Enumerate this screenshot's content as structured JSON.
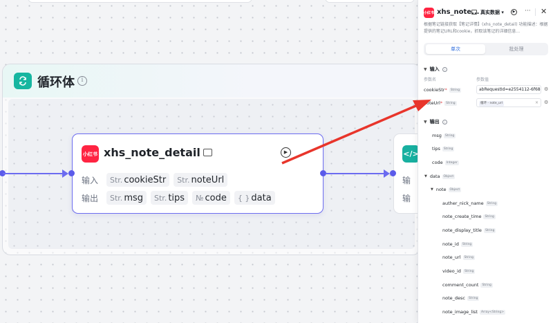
{
  "canvas": {
    "loop": {
      "title": "循环体"
    },
    "node": {
      "logo_text": "小红书",
      "title": "xhs_note_detail",
      "input_label": "输入",
      "output_label": "输出",
      "inputs": [
        {
          "type": "Str.",
          "name": "cookieStr"
        },
        {
          "type": "Str.",
          "name": "noteUrl"
        }
      ],
      "outputs": [
        {
          "type": "Str.",
          "name": "msg"
        },
        {
          "type": "Str.",
          "name": "tips"
        },
        {
          "type": "№",
          "name": "code"
        },
        {
          "type": "{ }",
          "name": "data"
        }
      ]
    },
    "next_node": {
      "logo_text": "</>",
      "input_label": "输",
      "output_label": "输"
    }
  },
  "panel": {
    "logo_text": "小红书",
    "title": "xhs_note...",
    "mode": "真实数据 ▾",
    "description": "根据笔记链接获取【笔记详情】(xhs_note_detail) 功能描述：根据提供的笔记URL和cookie，抓取该笔记的详细信息...",
    "tabs": [
      "单次",
      "批处理"
    ],
    "input_section": "输入",
    "col_param_name": "参数名",
    "col_param_value": "参数值",
    "inputs": [
      {
        "name": "cookieStr",
        "type": "String",
        "value": "abRequestId=e2554112-6f68-"
      },
      {
        "name": "noteUrl",
        "type": "String",
        "chip": "循环 - note_url"
      }
    ],
    "output_section": "输出",
    "outputs": [
      {
        "name": "msg",
        "type": "String"
      },
      {
        "name": "tips",
        "type": "String"
      },
      {
        "name": "code",
        "type": "Integer"
      },
      {
        "name": "data",
        "type": "Object"
      },
      {
        "name": "note",
        "type": "Object"
      },
      {
        "name": "auther_nick_name",
        "type": "String"
      },
      {
        "name": "note_create_time",
        "type": "String"
      },
      {
        "name": "note_display_title",
        "type": "String"
      },
      {
        "name": "note_id",
        "type": "String"
      },
      {
        "name": "note_url",
        "type": "String"
      },
      {
        "name": "video_id",
        "type": "String"
      },
      {
        "name": "comment_count",
        "type": "String"
      },
      {
        "name": "note_desc",
        "type": "String"
      },
      {
        "name": "note_image_list",
        "type": "Array<String>"
      }
    ]
  }
}
